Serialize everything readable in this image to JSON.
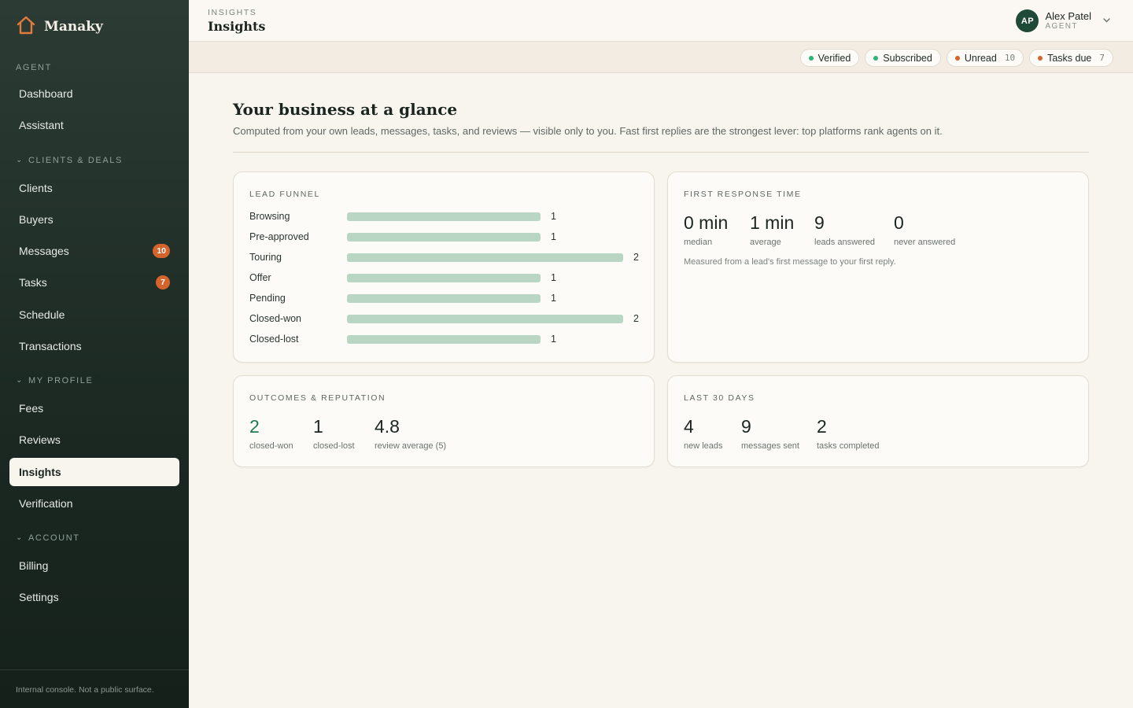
{
  "brand": {
    "name": "Manaky"
  },
  "sidebar": {
    "sections": {
      "agent": "AGENT",
      "clients_deals": "CLIENTS & DEALS",
      "my_profile": "MY PROFILE",
      "account": "ACCOUNT"
    },
    "items": {
      "dashboard": "Dashboard",
      "assistant": "Assistant",
      "clients": "Clients",
      "buyers": "Buyers",
      "messages": "Messages",
      "messages_badge": "10",
      "tasks": "Tasks",
      "tasks_badge": "7",
      "schedule": "Schedule",
      "transactions": "Transactions",
      "fees": "Fees",
      "reviews": "Reviews",
      "insights": "Insights",
      "verification": "Verification",
      "billing": "Billing",
      "settings": "Settings"
    },
    "footer": "Internal console. Not a public surface."
  },
  "header": {
    "breadcrumb": "INSIGHTS",
    "title": "Insights",
    "user": {
      "initials": "AP",
      "name": "Alex Patel",
      "role": "AGENT"
    }
  },
  "status": {
    "verified": "Verified",
    "subscribed": "Subscribed",
    "unread": "Unread",
    "unread_count": "10",
    "tasks_due": "Tasks due",
    "tasks_due_count": "7",
    "colors": {
      "ok": "#2bb37a",
      "alert": "#d4642c"
    }
  },
  "main": {
    "heading": "Your business at a glance",
    "subheading": "Computed from your own leads, messages, tasks, and reviews — visible only to you. Fast first replies are the strongest lever: top platforms rank agents on it."
  },
  "funnel": {
    "title": "LEAD FUNNEL",
    "rows": [
      {
        "label": "Browsing",
        "value": 1
      },
      {
        "label": "Pre-approved",
        "value": 1
      },
      {
        "label": "Touring",
        "value": 2
      },
      {
        "label": "Offer",
        "value": 1
      },
      {
        "label": "Pending",
        "value": 1
      },
      {
        "label": "Closed-won",
        "value": 2
      },
      {
        "label": "Closed-lost",
        "value": 1
      }
    ]
  },
  "response": {
    "title": "FIRST RESPONSE TIME",
    "median": "0 min",
    "median_label": "median",
    "average": "1 min",
    "average_label": "average",
    "answered": "9",
    "answered_label": "leads answered",
    "never": "0",
    "never_label": "never answered",
    "note": "Measured from a lead's first message to your first reply."
  },
  "outcomes": {
    "title": "OUTCOMES & REPUTATION",
    "won": "2",
    "won_label": "closed-won",
    "lost": "1",
    "lost_label": "closed-lost",
    "rating": "4.8",
    "rating_label": "review average (5)"
  },
  "last30": {
    "title": "LAST 30 DAYS",
    "leads": "4",
    "leads_label": "new leads",
    "messages": "9",
    "messages_label": "messages sent",
    "tasks": "2",
    "tasks_label": "tasks completed"
  }
}
